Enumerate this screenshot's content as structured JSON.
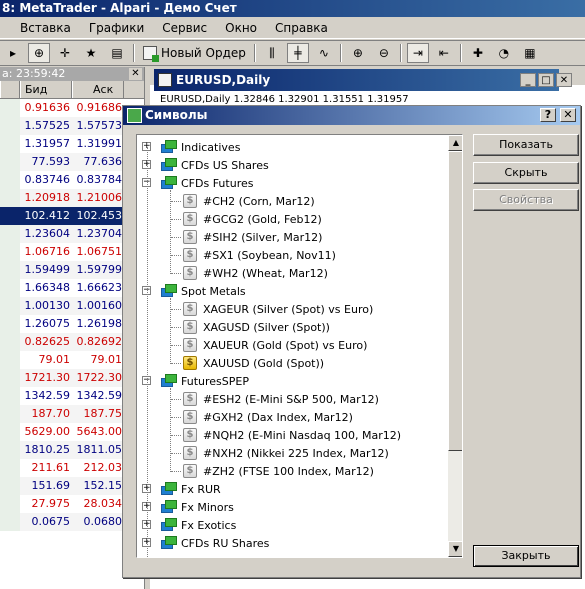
{
  "app": {
    "title": "8: MetaTrader - Alpari - Демо Счет"
  },
  "menu": [
    "Вставка",
    "Графики",
    "Сервис",
    "Окно",
    "Справка"
  ],
  "toolbar": {
    "new_order": "Новый Ордер"
  },
  "market_watch": {
    "time": "a: 23:59:42",
    "bid_header": "Бид",
    "ask_header": "Аск",
    "rows": [
      {
        "bid": "0.91636",
        "ask": "0.91686",
        "color": "#cc0000"
      },
      {
        "bid": "1.57525",
        "ask": "1.57573",
        "color": "#000080"
      },
      {
        "bid": "1.31957",
        "ask": "1.31991",
        "color": "#000080"
      },
      {
        "bid": "77.593",
        "ask": "77.636",
        "color": "#000080"
      },
      {
        "bid": "0.83746",
        "ask": "0.83784",
        "color": "#000080"
      },
      {
        "bid": "1.20918",
        "ask": "1.21006",
        "color": "#cc0000"
      },
      {
        "bid": "102.412",
        "ask": "102.453",
        "color": "#ffffff"
      },
      {
        "bid": "1.23604",
        "ask": "1.23704",
        "color": "#000080"
      },
      {
        "bid": "1.06716",
        "ask": "1.06751",
        "color": "#cc0000"
      },
      {
        "bid": "1.59499",
        "ask": "1.59799",
        "color": "#000080"
      },
      {
        "bid": "1.66348",
        "ask": "1.66623",
        "color": "#000080"
      },
      {
        "bid": "1.00130",
        "ask": "1.00160",
        "color": "#000080"
      },
      {
        "bid": "1.26075",
        "ask": "1.26198",
        "color": "#000080"
      },
      {
        "bid": "0.82625",
        "ask": "0.82692",
        "color": "#cc0000"
      },
      {
        "bid": "79.01",
        "ask": "79.01",
        "color": "#cc0000"
      },
      {
        "bid": "1721.30",
        "ask": "1722.30",
        "color": "#cc0000"
      },
      {
        "bid": "1342.59",
        "ask": "1342.59",
        "color": "#000080"
      },
      {
        "bid": "187.70",
        "ask": "187.75",
        "color": "#cc0000"
      },
      {
        "bid": "5629.00",
        "ask": "5643.00",
        "color": "#cc0000"
      },
      {
        "bid": "1810.25",
        "ask": "1811.05",
        "color": "#000080"
      },
      {
        "bid": "211.61",
        "ask": "212.03",
        "color": "#cc0000"
      },
      {
        "bid": "151.69",
        "ask": "152.15",
        "color": "#000080"
      },
      {
        "bid": "27.975",
        "ask": "28.034",
        "color": "#cc0000"
      },
      {
        "bid": "0.0675",
        "ask": "0.0680",
        "color": "#000080"
      }
    ]
  },
  "chart": {
    "title": "EURUSD,Daily",
    "info": "EURUSD,Daily  1.32846 1.32901 1.31551 1.31957"
  },
  "dialog": {
    "title": "Символы",
    "help": "?",
    "close": "✕",
    "buttons": {
      "show": "Показать",
      "hide": "Скрыть",
      "properties": "Свойства",
      "close": "Закрыть"
    },
    "tree": [
      {
        "type": "group",
        "label": "Indicatives",
        "expanded": false
      },
      {
        "type": "group",
        "label": "CFDs US Shares",
        "expanded": false
      },
      {
        "type": "group",
        "label": "CFDs Futures",
        "expanded": true
      },
      {
        "type": "symbol",
        "label": "#CH2  (Corn, Mar12)",
        "gold": false
      },
      {
        "type": "symbol",
        "label": "#GCG2  (Gold, Feb12)",
        "gold": false
      },
      {
        "type": "symbol",
        "label": "#SIH2  (Silver, Mar12)",
        "gold": false
      },
      {
        "type": "symbol",
        "label": "#SX1  (Soybean, Nov11)",
        "gold": false
      },
      {
        "type": "symbol",
        "label": "#WH2  (Wheat, Mar12)",
        "gold": false
      },
      {
        "type": "group",
        "label": "Spot Metals",
        "expanded": true
      },
      {
        "type": "symbol",
        "label": "XAGEUR  (Silver (Spot) vs Euro)",
        "gold": false
      },
      {
        "type": "symbol",
        "label": "XAGUSD  (Silver (Spot))",
        "gold": false
      },
      {
        "type": "symbol",
        "label": "XAUEUR  (Gold (Spot) vs Euro)",
        "gold": false
      },
      {
        "type": "symbol",
        "label": "XAUUSD  (Gold (Spot))",
        "gold": true
      },
      {
        "type": "group",
        "label": "FuturesSPEP",
        "expanded": true
      },
      {
        "type": "symbol",
        "label": "#ESH2  (E-Mini S&P 500, Mar12)",
        "gold": false
      },
      {
        "type": "symbol",
        "label": "#GXH2  (Dax Index, Mar12)",
        "gold": false
      },
      {
        "type": "symbol",
        "label": "#NQH2  (E-Mini Nasdaq 100, Mar12)",
        "gold": false
      },
      {
        "type": "symbol",
        "label": "#NXH2  (Nikkei 225 Index, Mar12)",
        "gold": false
      },
      {
        "type": "symbol",
        "label": "#ZH2  (FTSE 100 Index, Mar12)",
        "gold": false
      },
      {
        "type": "group",
        "label": "Fx RUR",
        "expanded": false
      },
      {
        "type": "group",
        "label": "Fx Minors",
        "expanded": false
      },
      {
        "type": "group",
        "label": "Fx Exotics",
        "expanded": false
      },
      {
        "type": "group",
        "label": "CFDs RU Shares",
        "expanded": false
      }
    ]
  }
}
